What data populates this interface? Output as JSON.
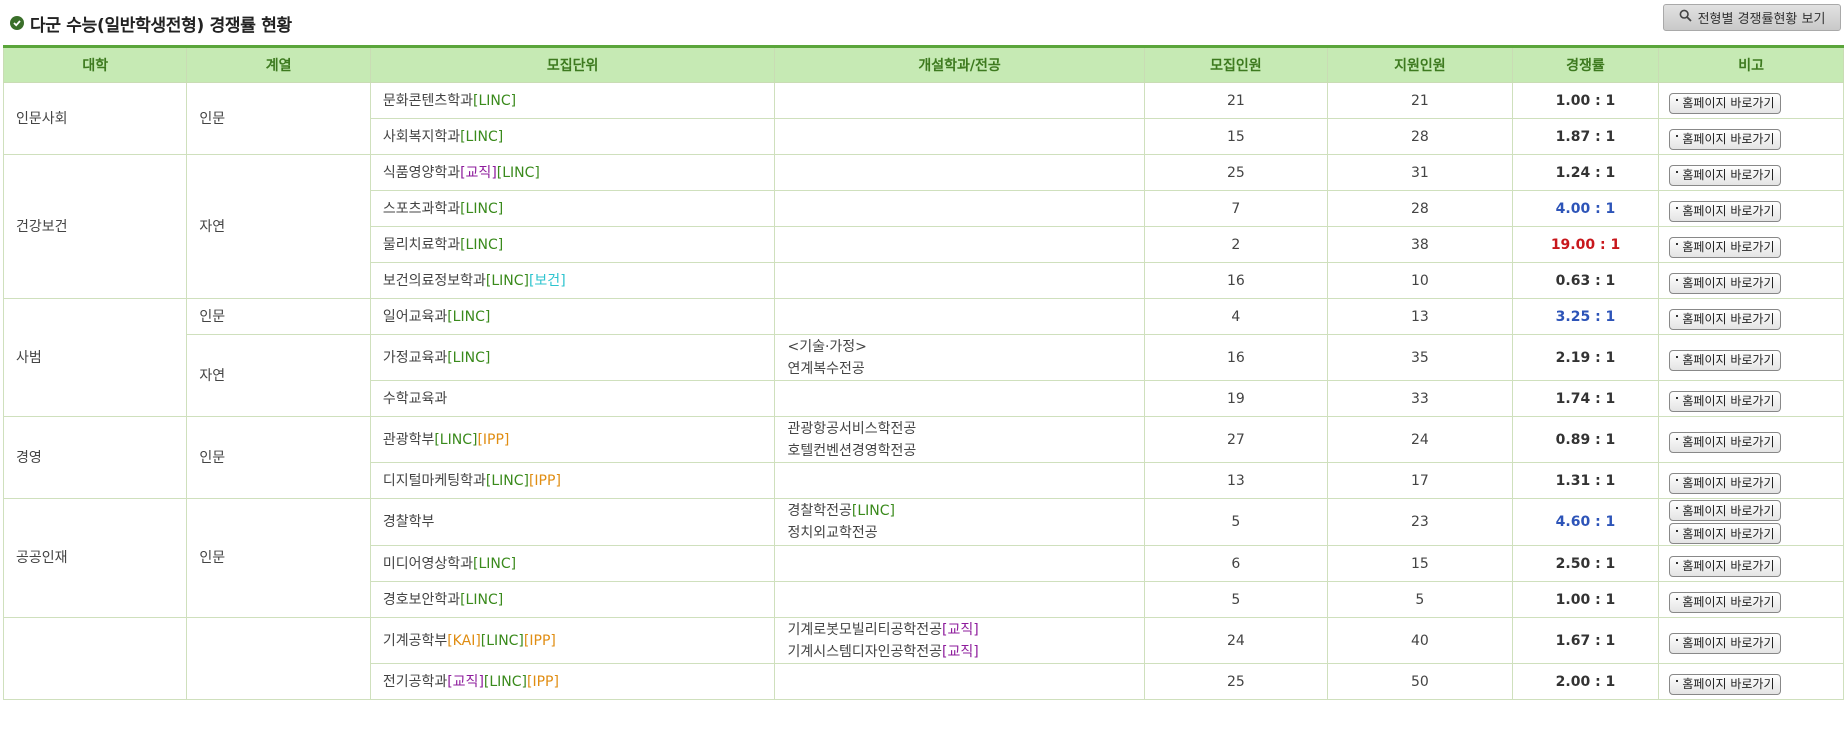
{
  "title": "다군 수능(일반학생전형) 경쟁률 현황",
  "top_button": "전형별 경쟁률현황 보기",
  "go_button": "홈페이지 바로가기",
  "headers": [
    "대학",
    "계열",
    "모집단위",
    "개설학과/전공",
    "모집인원",
    "지원인원",
    "경쟁률",
    "비고"
  ],
  "rows": [
    {
      "college": "인문사회",
      "field": "인문",
      "unit": "문화콘텐츠학과",
      "tag1": "[LINC]",
      "major1": "",
      "major2": "",
      "recruit": "21",
      "applied": "21",
      "rate": "1.00 : 1"
    },
    {
      "unit": "사회복지학과",
      "tag1": "[LINC]",
      "recruit": "15",
      "applied": "28",
      "rate": "1.87 : 1"
    },
    {
      "college": "건강보건",
      "field": "자연",
      "unit": "식품영양학과",
      "tag1": "[교직]",
      "tag2": "[LINC]",
      "recruit": "25",
      "applied": "31",
      "rate": "1.24 : 1"
    },
    {
      "unit": "스포츠과학과",
      "tag1": "[LINC]",
      "recruit": "7",
      "applied": "28",
      "rate": "4.00 : 1"
    },
    {
      "unit": "물리치료학과",
      "tag1": "[LINC]",
      "recruit": "2",
      "applied": "38",
      "rate": "19.00 : 1"
    },
    {
      "unit": "보건의료정보학과",
      "tag1": "[LINC]",
      "tag2": "[보건]",
      "recruit": "16",
      "applied": "10",
      "rate": "0.63 : 1"
    },
    {
      "college": "사범",
      "field": "인문",
      "unit": "일어교육과",
      "tag1": "[LINC]",
      "recruit": "4",
      "applied": "13",
      "rate": "3.25 : 1"
    },
    {
      "field": "자연",
      "unit": "가정교육과",
      "tag1": "[LINC]",
      "major1": "<기술·가정>",
      "major2": "연계복수전공",
      "recruit": "16",
      "applied": "35",
      "rate": "2.19 : 1"
    },
    {
      "unit": "수학교육과",
      "recruit": "19",
      "applied": "33",
      "rate": "1.74 : 1"
    },
    {
      "college": "경영",
      "field": "인문",
      "unit": "관광학부",
      "tag1": "[LINC]",
      "tag2": "[IPP]",
      "major1": "관광항공서비스학전공",
      "major2": "호텔컨벤션경영학전공",
      "recruit": "27",
      "applied": "24",
      "rate": "0.89 : 1"
    },
    {
      "unit": "디지털마케팅학과",
      "tag1": "[LINC]",
      "tag2": "[IPP]",
      "recruit": "13",
      "applied": "17",
      "rate": "1.31 : 1"
    },
    {
      "college": "공공인재",
      "field": "인문",
      "unit": "경찰학부",
      "major1": "경찰학전공",
      "major1tag": "[LINC]",
      "major2": "정치외교학전공",
      "recruit": "5",
      "applied": "23",
      "rate": "4.60 : 1"
    },
    {
      "unit": "미디어영상학과",
      "tag1": "[LINC]",
      "recruit": "6",
      "applied": "15",
      "rate": "2.50 : 1"
    },
    {
      "unit": "경호보안학과",
      "tag1": "[LINC]",
      "recruit": "5",
      "applied": "5",
      "rate": "1.00 : 1"
    },
    {
      "unit": "기계공학부",
      "tag1": "[KAI]",
      "tag2": "[LINC]",
      "tag3": "[IPP]",
      "major1": "기계로봇모빌리티공학전공",
      "major1tag": "[교직]",
      "major2": "기계시스템디자인공학전공",
      "major2tag": "[교직]",
      "recruit": "24",
      "applied": "40",
      "rate": "1.67 : 1"
    },
    {
      "unit": "전기공학과",
      "tag1": "[교직]",
      "tag2": "[LINC]",
      "tag3": "[IPP]",
      "recruit": "25",
      "applied": "50",
      "rate": "2.00 : 1"
    }
  ],
  "colors": {
    "header_bg": "#c6eab4",
    "header_text": "#3d7a1f",
    "tag_green": "#3a8a1c",
    "tag_purple": "#8e1c9c",
    "tag_orange": "#e08d12",
    "tag_cyan": "#2ec4cf",
    "rate_blue": "#2d54b8",
    "rate_red": "#c8171c"
  }
}
